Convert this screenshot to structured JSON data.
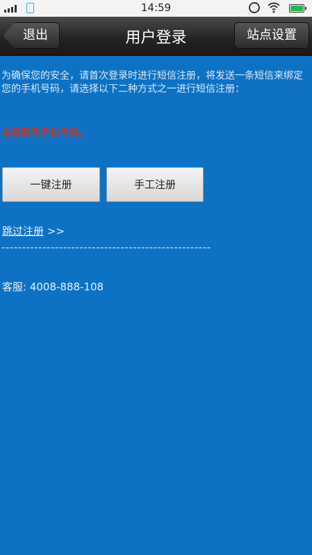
{
  "status_bar": {
    "time": "14:59"
  },
  "header": {
    "title": "用户登录",
    "back_label": "退出",
    "settings_label": "站点设置"
  },
  "main": {
    "intro_text": "为确保您的安全，请首次登录时进行短信注册，将发送一条短信来绑定您的手机号码，请选择以下二种方式之一进行短信注册：",
    "warning_text": "未获取到手机号码。",
    "one_key_button": "一键注册",
    "manual_button": "手工注册",
    "skip_link": "跳过注册",
    "skip_arrows": ">>",
    "divider": "---------------------------------------------------",
    "service_label": "客服:",
    "service_phone": "4008-888-108"
  },
  "colors": {
    "background": "#0d72c4",
    "warning": "#c0392b"
  },
  "icons": [
    "signal-icon",
    "sim-icon",
    "alarm-icon",
    "wifi-icon",
    "battery-icon"
  ]
}
